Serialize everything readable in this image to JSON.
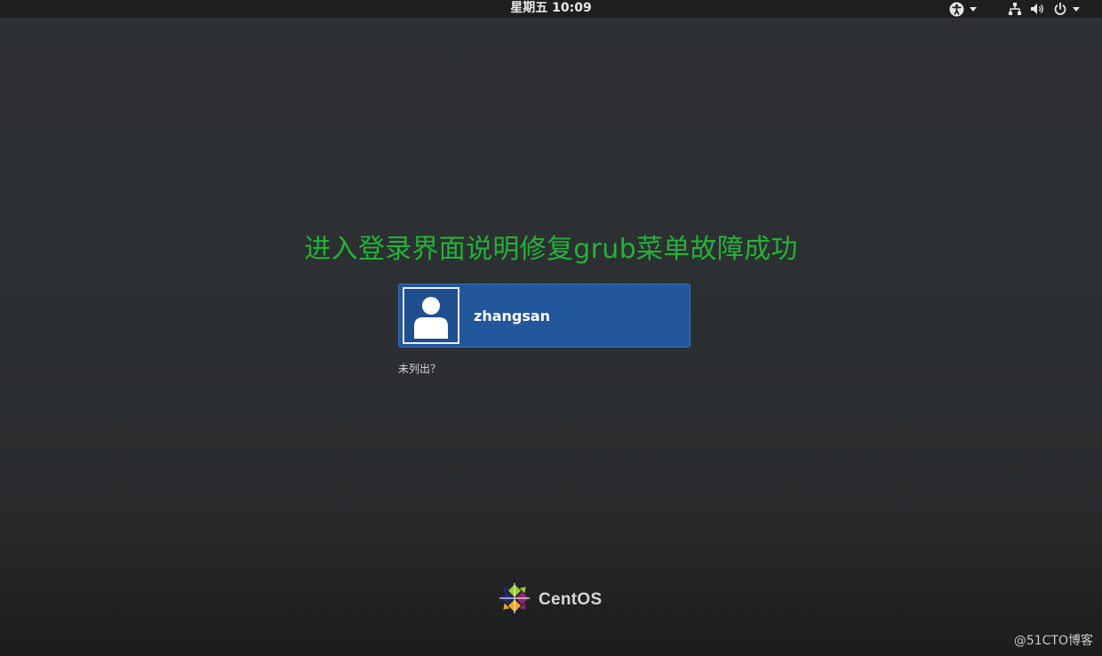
{
  "top_bar": {
    "clock": "星期五 10:09",
    "icons": [
      "accessibility-icon",
      "network-icon",
      "volume-icon",
      "power-icon"
    ]
  },
  "annotation": {
    "text": "进入登录界面说明修复grub菜单故障成功",
    "color": "#23b238"
  },
  "user_list": {
    "users": [
      {
        "name": "zhangsan"
      }
    ],
    "not_listed_label": "未列出？"
  },
  "brand": {
    "logo_text": "CentOS"
  },
  "watermark": "@51CTO博客",
  "colors": {
    "background": "#2c2f31",
    "top_bar": "#1d1e1f",
    "user_card": "#22579c"
  }
}
